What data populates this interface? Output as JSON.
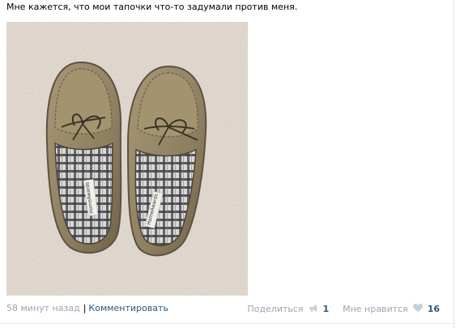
{
  "post": {
    "text": "Мне кажется, что мои тапочки что-то задумали против меня.",
    "image_alt": "photo-slippers"
  },
  "slippers": {
    "brand_left": "HomeAwards",
    "brand_right": "HomeAwards"
  },
  "footer": {
    "time": "58 минут назад",
    "separator": "|",
    "comment": "Комментировать",
    "share_label": "Поделиться",
    "share_count": "1",
    "like_label": "Мне нравится",
    "like_count": "16"
  },
  "colors": {
    "link": "#2b587a",
    "muted": "#9aa5b1",
    "icon": "#c5d0da"
  }
}
